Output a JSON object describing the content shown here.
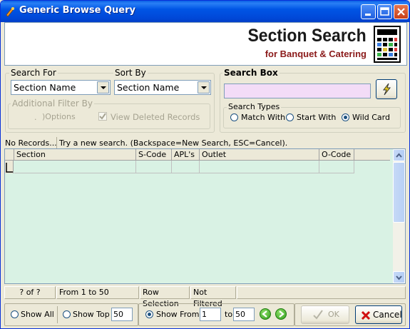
{
  "window": {
    "title": "Generic Browse Query"
  },
  "banner": {
    "title": "Section Search",
    "subtitle": "for Banquet & Catering"
  },
  "search_for": {
    "label": "Search For",
    "value": "Section Name"
  },
  "sort_by": {
    "label": "Sort By",
    "value": "Section Name"
  },
  "filter": {
    "label": "Additional Filter By",
    "options_label": "Options",
    "view_deleted_label": "View Deleted Records",
    "view_deleted_checked": true
  },
  "search_box": {
    "label": "Search Box",
    "value": "",
    "search_types_label": "Search Types",
    "types": [
      "Match With",
      "Start With",
      "Wild Card"
    ],
    "selected_type": "Wild Card"
  },
  "status": {
    "records": "No Records...",
    "hint": "Try a new search. (Backspace=New Search, ESC=Cancel)."
  },
  "grid": {
    "columns": [
      "Section",
      "S-Code",
      "APL's",
      "Outlet",
      "O-Code"
    ],
    "rows": []
  },
  "footer_status": {
    "position": "? of ?",
    "range": "From 1 to 50",
    "selection_mode": "Row Selection",
    "filter_state": "Not Filtered"
  },
  "paging": {
    "show_all_label": "Show All",
    "show_top_label": "Show Top",
    "show_top_value": "50",
    "show_from_label": "Show From",
    "from_value": "1",
    "to_label": "to",
    "to_value": "50",
    "selected": "Show From"
  },
  "buttons": {
    "ok_label": "OK",
    "cancel_label": "Cancel"
  },
  "colors": {
    "title_bar": "#0055e5",
    "grid_background": "#d9f2e4",
    "search_box_background": "#f3dcf7",
    "banner_subtitle": "#8b1a1a"
  }
}
